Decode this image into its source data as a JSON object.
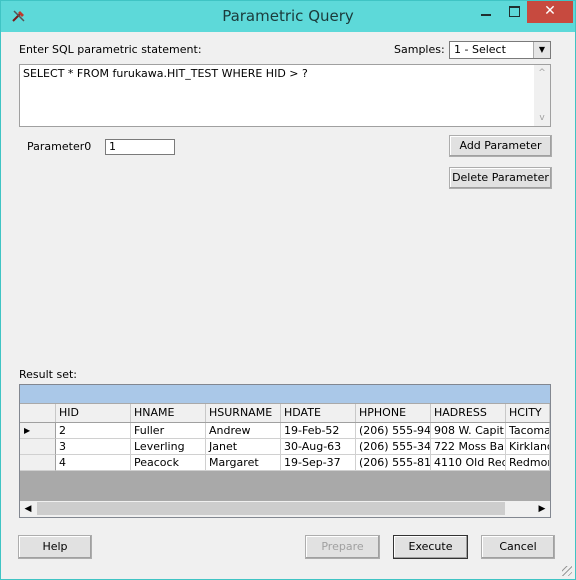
{
  "window": {
    "title": "Parametric Query"
  },
  "titlebar": {
    "minimize": "–",
    "close": "✕"
  },
  "sql": {
    "label": "Enter SQL parametric statement:",
    "statement": "SELECT * FROM furukawa.HIT_TEST WHERE HID > ?",
    "scroll_up": "^",
    "scroll_down": "v"
  },
  "samples": {
    "label": "Samples:",
    "selected": "1 - Select",
    "arrow": "▼"
  },
  "parameters": [
    {
      "label": "Parameter0",
      "value": "1"
    }
  ],
  "buttons": {
    "add_parameter": "Add Parameter",
    "delete_parameter": "Delete Parameter",
    "help": "Help",
    "prepare": "Prepare",
    "execute": "Execute",
    "cancel": "Cancel"
  },
  "result": {
    "label": "Result set:",
    "columns": [
      "HID",
      "HNAME",
      "HSURNAME",
      "HDATE",
      "HPHONE",
      "HADRESS",
      "HCITY"
    ],
    "rows": [
      [
        "2",
        "Fuller",
        "Andrew",
        "19-Feb-52",
        "(206) 555-94",
        "908 W. Capit",
        "Tacoma"
      ],
      [
        "3",
        "Leverling",
        "Janet",
        "30-Aug-63",
        "(206) 555-34",
        "722 Moss Ba",
        "Kirkland"
      ],
      [
        "4",
        "Peacock",
        "Margaret",
        "19-Sep-37",
        "(206) 555-81",
        "4110 Old Red",
        "Redmond"
      ]
    ],
    "current_row_marker": "▶",
    "scroll_left": "◀",
    "scroll_right": "▶"
  }
}
